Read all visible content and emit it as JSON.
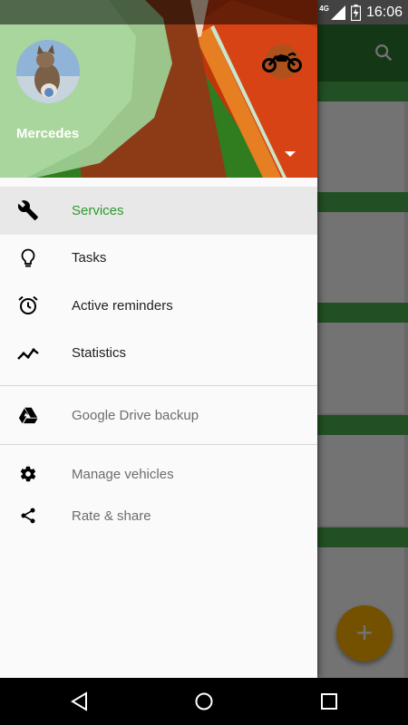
{
  "status_bar": {
    "network": "4G",
    "time": "16:06"
  },
  "drawer": {
    "account": {
      "name": "Mercedes"
    },
    "items": [
      {
        "label": "Services",
        "icon": "wrench-icon",
        "active": true
      },
      {
        "label": "Tasks",
        "icon": "lightbulb-icon"
      },
      {
        "label": "Active reminders",
        "icon": "alarm-clock-icon"
      },
      {
        "label": "Statistics",
        "icon": "trending-line-icon"
      }
    ],
    "backup": {
      "label": "Google Drive backup",
      "icon": "google-drive-icon"
    },
    "secondary": [
      {
        "label": "Manage vehicles",
        "icon": "gear-icon"
      },
      {
        "label": "Rate & share",
        "icon": "share-icon"
      }
    ]
  },
  "fab": {
    "label": "+"
  },
  "colors": {
    "primary": "#2e7d32",
    "active_text": "#2e9a2e",
    "fab": "#ffb300"
  }
}
